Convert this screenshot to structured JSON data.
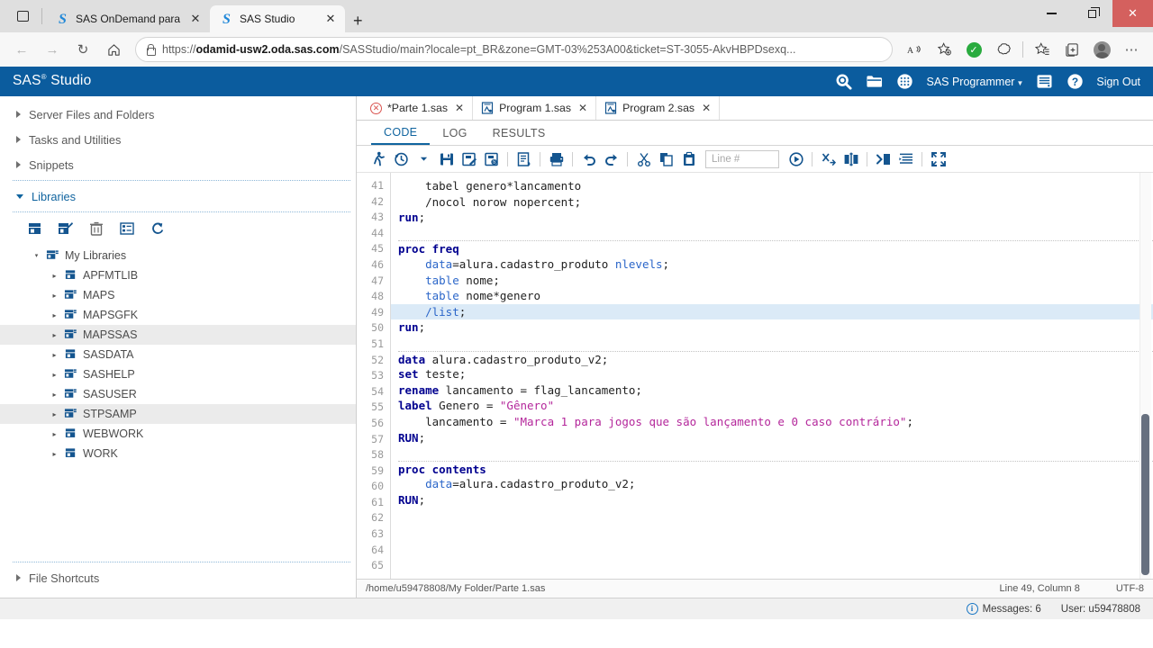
{
  "browser": {
    "tabs": [
      {
        "title": "SAS OnDemand para académico",
        "icon": "sas-favicon",
        "active": false
      },
      {
        "title": "SAS Studio",
        "icon": "sas-favicon",
        "active": true
      }
    ],
    "new_tab_label": "+",
    "close_label": "✕",
    "nav": {
      "back": "←",
      "forward": "→",
      "refresh": "↻",
      "home": "⌂"
    },
    "url": {
      "scheme": "https://",
      "domain": "odamid-usw2.oda.sas.com",
      "path": "/SASStudio/main?locale=pt_BR&zone=GMT-03%253A00&ticket=ST-3055-AkvHBPDsexq...",
      "full": "https://odamid-usw2.oda.sas.com/SASStudio/main?locale=pt_BR&zone=GMT-03%253A00&ticket=ST-3055-AkvHBPDsexq..."
    },
    "window_controls": {
      "minimize": "–",
      "restore": "❐",
      "close": "✕"
    }
  },
  "sas_header": {
    "product": "SAS",
    "trademark": "®",
    "product_suffix": "Studio",
    "role": "SAS Programmer",
    "sign_out": "Sign Out",
    "brand_color": "#0b5c9e"
  },
  "sidebar": {
    "sections": [
      {
        "label": "Server Files and Folders",
        "expanded": false
      },
      {
        "label": "Tasks and Utilities",
        "expanded": false
      },
      {
        "label": "Snippets",
        "expanded": false
      },
      {
        "label": "Libraries",
        "expanded": true
      }
    ],
    "file_shortcuts": {
      "label": "File Shortcuts",
      "expanded": false
    },
    "libraries_toolbar": [
      "new-library-icon",
      "edit-library-icon",
      "delete-library-icon",
      "library-properties-icon",
      "refresh-icon"
    ],
    "tree": {
      "root": {
        "label": "My Libraries",
        "expanded": true
      },
      "items": [
        {
          "label": "APFMTLIB",
          "selected": false,
          "kind": "single"
        },
        {
          "label": "MAPS",
          "selected": false,
          "kind": "stack"
        },
        {
          "label": "MAPSGFK",
          "selected": false,
          "kind": "stack"
        },
        {
          "label": "MAPSSAS",
          "selected": true,
          "kind": "stack"
        },
        {
          "label": "SASDATA",
          "selected": false,
          "kind": "single"
        },
        {
          "label": "SASHELP",
          "selected": false,
          "kind": "stack"
        },
        {
          "label": "SASUSER",
          "selected": false,
          "kind": "stack"
        },
        {
          "label": "STPSAMP",
          "selected": true,
          "kind": "stack"
        },
        {
          "label": "WEBWORK",
          "selected": false,
          "kind": "single"
        },
        {
          "label": "WORK",
          "selected": false,
          "kind": "single"
        }
      ]
    }
  },
  "editor": {
    "tabs": [
      {
        "label": "*Parte 1.sas",
        "active": true,
        "status": "error"
      },
      {
        "label": "Program 1.sas",
        "active": false,
        "status": "ok"
      },
      {
        "label": "Program 2.sas",
        "active": false,
        "status": "ok"
      }
    ],
    "subtabs": [
      {
        "label": "CODE",
        "active": true
      },
      {
        "label": "LOG",
        "active": false
      },
      {
        "label": "RESULTS",
        "active": false
      }
    ],
    "toolbar": {
      "icons_left": [
        "run-icon",
        "run-history-icon",
        "save-icon",
        "save-as-icon",
        "save-all-icon",
        "properties-icon",
        "print-icon",
        "undo-icon",
        "redo-icon",
        "cut-icon",
        "copy-icon",
        "paste-icon"
      ],
      "line_input_placeholder": "Line #",
      "icons_right": [
        "go-to-line-icon",
        "clear-all-icon",
        "compare-icon",
        "insert-macro-icon",
        "format-code-icon",
        "maximize-view-icon"
      ]
    },
    "status": {
      "path": "/home/u59478808/My Folder/Parte 1.sas",
      "cursor": "Line 49, Column 8",
      "encoding": "UTF-8"
    },
    "first_line_number": 41,
    "highlight_line": 49,
    "code_lines": [
      {
        "n": 41,
        "tokens": [
          {
            "t": "plain",
            "v": "    tabel genero*lancamento"
          }
        ]
      },
      {
        "n": 42,
        "tokens": [
          {
            "t": "plain",
            "v": "    /nocol norow nopercent;"
          }
        ]
      },
      {
        "n": 43,
        "tokens": [
          {
            "t": "kw",
            "v": "run"
          },
          {
            "t": "plain",
            "v": ";"
          }
        ]
      },
      {
        "n": 44,
        "tokens": []
      },
      {
        "n": 45,
        "tokens": [
          {
            "t": "kw",
            "v": "proc freq"
          }
        ],
        "sep_above": true
      },
      {
        "n": 46,
        "tokens": [
          {
            "t": "plain",
            "v": "    "
          },
          {
            "t": "opt",
            "v": "data"
          },
          {
            "t": "plain",
            "v": "=alura.cadastro_produto "
          },
          {
            "t": "opt",
            "v": "nlevels"
          },
          {
            "t": "plain",
            "v": ";"
          }
        ]
      },
      {
        "n": 47,
        "tokens": [
          {
            "t": "plain",
            "v": "    "
          },
          {
            "t": "opt",
            "v": "table"
          },
          {
            "t": "plain",
            "v": " nome;"
          }
        ]
      },
      {
        "n": 48,
        "tokens": [
          {
            "t": "plain",
            "v": "    "
          },
          {
            "t": "opt",
            "v": "table"
          },
          {
            "t": "plain",
            "v": " nome*genero"
          }
        ]
      },
      {
        "n": 49,
        "tokens": [
          {
            "t": "plain",
            "v": "    "
          },
          {
            "t": "opt",
            "v": "/list"
          },
          {
            "t": "plain",
            "v": ";"
          }
        ]
      },
      {
        "n": 50,
        "tokens": [
          {
            "t": "kw",
            "v": "run"
          },
          {
            "t": "plain",
            "v": ";"
          }
        ]
      },
      {
        "n": 51,
        "tokens": []
      },
      {
        "n": 52,
        "tokens": [
          {
            "t": "kw",
            "v": "data"
          },
          {
            "t": "plain",
            "v": " alura.cadastro_produto_v2;"
          }
        ],
        "sep_above": true
      },
      {
        "n": 53,
        "tokens": [
          {
            "t": "kw",
            "v": "set"
          },
          {
            "t": "plain",
            "v": " teste;"
          }
        ]
      },
      {
        "n": 54,
        "tokens": [
          {
            "t": "kw",
            "v": "rename"
          },
          {
            "t": "plain",
            "v": " lancamento = flag_lancamento;"
          }
        ]
      },
      {
        "n": 55,
        "tokens": [
          {
            "t": "kw",
            "v": "label"
          },
          {
            "t": "plain",
            "v": " Genero = "
          },
          {
            "t": "str",
            "v": "\"Gênero\""
          }
        ]
      },
      {
        "n": 56,
        "tokens": [
          {
            "t": "plain",
            "v": "    lancamento = "
          },
          {
            "t": "str",
            "v": "\"Marca 1 para jogos que são lançamento e 0 caso contrário\""
          },
          {
            "t": "plain",
            "v": ";"
          }
        ]
      },
      {
        "n": 57,
        "tokens": [
          {
            "t": "kw",
            "v": "RUN"
          },
          {
            "t": "plain",
            "v": ";"
          }
        ]
      },
      {
        "n": 58,
        "tokens": []
      },
      {
        "n": 59,
        "tokens": [
          {
            "t": "kw",
            "v": "proc contents"
          }
        ],
        "sep_above": true
      },
      {
        "n": 60,
        "tokens": [
          {
            "t": "plain",
            "v": "    "
          },
          {
            "t": "opt",
            "v": "data"
          },
          {
            "t": "plain",
            "v": "=alura.cadastro_produto_v2;"
          }
        ]
      },
      {
        "n": 61,
        "tokens": [
          {
            "t": "kw",
            "v": "RUN"
          },
          {
            "t": "plain",
            "v": ";"
          }
        ]
      },
      {
        "n": 62,
        "tokens": []
      },
      {
        "n": 63,
        "tokens": []
      },
      {
        "n": 64,
        "tokens": []
      },
      {
        "n": 65,
        "tokens": []
      }
    ]
  },
  "bottom_bar": {
    "messages_label": "Messages: 6",
    "user_label": "User: u59478808"
  },
  "colors": {
    "sas_blue": "#0b5c9e",
    "keyword": "#00008f",
    "option": "#2b66c9",
    "string": "#b4279b",
    "selection": "#dbeaf7"
  }
}
